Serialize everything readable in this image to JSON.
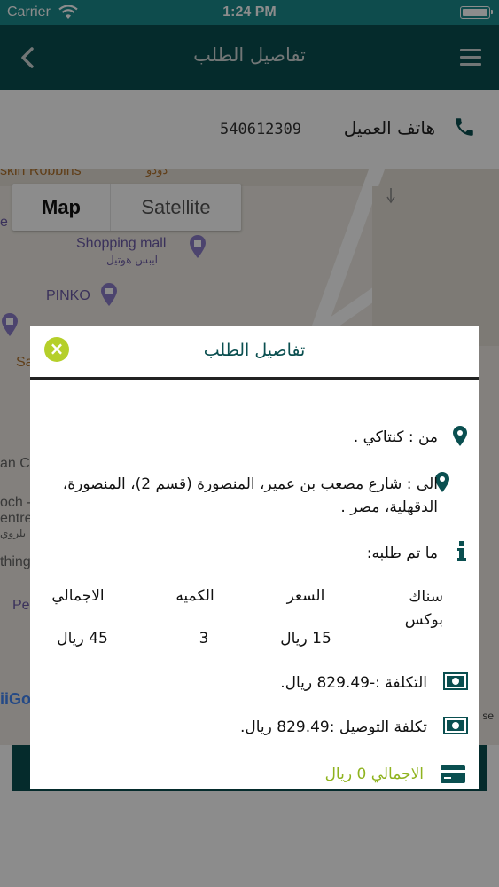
{
  "status_bar": {
    "carrier": "Carrier",
    "time": "1:24 PM"
  },
  "nav": {
    "title": "تفاصيل الطلب"
  },
  "customer": {
    "phone_label": "هاتف العميل",
    "phone_number": "540612309"
  },
  "map": {
    "type_control": {
      "map": "Map",
      "satellite": "Satellite"
    },
    "pois": {
      "baskin": "skin Robbins",
      "dodo": "دودو",
      "shopping_mall": "Shopping mall",
      "shopping_mall_ar": "ايبس هوتيل",
      "pinko": "PINKO",
      "left_e": "e",
      "sa": "Sa",
      "an_cl": "an Cl",
      "och": "och -",
      "entre": "entre",
      "ar_small": "يلروي",
      "thing": "thing",
      "pe": "Pe"
    },
    "google": "iiGo",
    "terms": "se"
  },
  "modal": {
    "title": "تفاصيل الطلب",
    "from": "من : كنتاكي .",
    "to": "الى : شارع مصعب بن عمير، المنصورة (قسم 2)، المنصورة، الدقهلية، مصر .",
    "ordered": "ما تم طلبه:",
    "table": {
      "headers": [
        "سناك بوكس",
        "السعر",
        "الكميه",
        "الاجمالي"
      ],
      "row": [
        "",
        "15 ريال",
        "3",
        "45 ريال"
      ]
    },
    "cost": "التكلفة :-829.49 ريال.",
    "delivery": "تكلفة التوصيل :829.49 ريال.",
    "total": "الاجمالي 0 ريال"
  },
  "colors": {
    "teal": "#0a4f50",
    "status_teal": "#1b8a8c",
    "lime": "#b5cf2a"
  }
}
